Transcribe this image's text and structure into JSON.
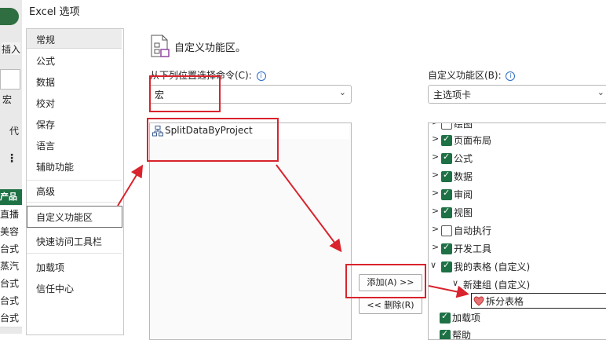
{
  "background_app": {
    "ribbon_tab_fragment": "插入",
    "macro_button_label": "宏",
    "code_fragment": "代",
    "more_glyph": "⋮",
    "sheet_header_fragment": "产品",
    "sheet_rows": [
      "直播",
      "美容",
      "台式",
      "蒸汽",
      "台式",
      "台式",
      "台式"
    ]
  },
  "dialog": {
    "title": "Excel 选项",
    "nav": {
      "items": [
        {
          "label": "常规"
        },
        {
          "label": "公式"
        },
        {
          "label": "数据"
        },
        {
          "label": "校对"
        },
        {
          "label": "保存"
        },
        {
          "label": "语言"
        },
        {
          "label": "辅助功能"
        },
        {
          "label": "高级"
        },
        {
          "label": "自定义功能区"
        },
        {
          "label": "快速访问工具栏"
        },
        {
          "label": "加载项"
        },
        {
          "label": "信任中心"
        }
      ],
      "selected": "自定义功能区"
    },
    "header": {
      "label": "自定义功能区。"
    },
    "choose_commands": {
      "label": "从下列位置选择命令(C):",
      "selected_value": "宏",
      "info_glyph": "i",
      "chevron": "⌄"
    },
    "commands_list": {
      "items": [
        {
          "label": "SplitDataByProject"
        }
      ]
    },
    "customize_ribbon": {
      "label": "自定义功能区(B):",
      "selected_value": "主选项卡",
      "info_glyph": "i",
      "chevron": "⌄"
    },
    "ribbon_tree": {
      "rows": [
        {
          "label": "绘图",
          "checked": false
        },
        {
          "label": "页面布局",
          "checked": true
        },
        {
          "label": "公式",
          "checked": true
        },
        {
          "label": "数据",
          "checked": true
        },
        {
          "label": "审阅",
          "checked": true
        },
        {
          "label": "视图",
          "checked": true
        },
        {
          "label": "自动执行",
          "checked": false
        },
        {
          "label": "开发工具",
          "checked": true
        },
        {
          "label": "我的表格 (自定义)",
          "checked": true
        },
        {
          "label": "新建组 (自定义)"
        },
        {
          "label": "拆分表格"
        },
        {
          "label": "加载项",
          "checked": true
        },
        {
          "label": "帮助",
          "checked": true
        }
      ]
    },
    "buttons": {
      "add": "添加(A) >>",
      "remove": "<< 删除(R)"
    }
  },
  "colors": {
    "highlight": "#d9232d",
    "check_green": "#1e7145",
    "info_blue": "#2b6cc4"
  }
}
